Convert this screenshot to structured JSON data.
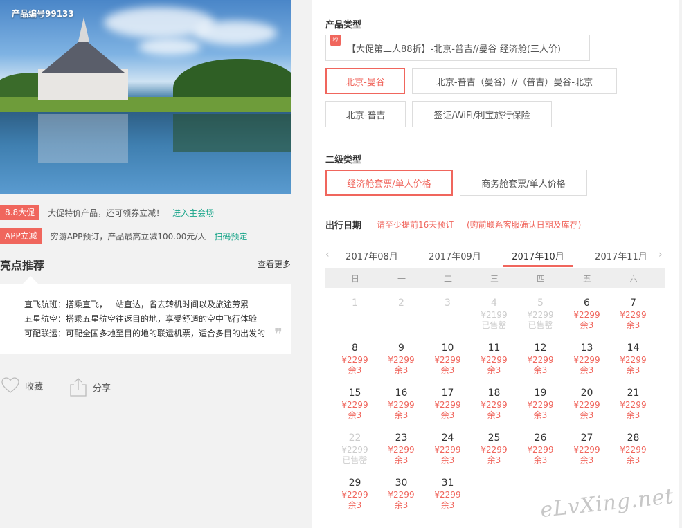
{
  "hero": {
    "product_no": "产品编号99133"
  },
  "promos": [
    {
      "tag": "8.8大促",
      "desc": "大促特价产品，还可领券立减！",
      "link": "进入主会场"
    },
    {
      "tag": "APP立减",
      "desc": "穷游APP预订，产品最高立减100.00元/人",
      "link": "扫码预定"
    }
  ],
  "highlights": {
    "title": "亮点推荐",
    "more": "查看更多",
    "lines": [
      "直飞航班：搭乘直飞，一站直达，省去转机时间以及旅途劳累",
      "五星航空：搭乘五星航空往返目的地，享受舒适的空中飞行体验",
      "可配联运：可配全国多地至目的地的联运机票，适合多目的出发的"
    ]
  },
  "actions": {
    "fav": "收藏",
    "share": "分享"
  },
  "product_type": {
    "label": "产品类型",
    "main_option": "【大促第二人88折】-北京-普吉//曼谷 经济舱(三人价)",
    "badge": "秒",
    "options": [
      "北京-曼谷",
      "北京-普吉（曼谷）//（普吉）曼谷-北京",
      "北京-普吉",
      "签证/WiFi/利宝旅行保险"
    ]
  },
  "sub_type": {
    "label": "二级类型",
    "options": [
      "经济舱套票/单人价格",
      "商务舱套票/单人价格"
    ]
  },
  "date": {
    "label": "出行日期",
    "note1": "请至少提前16天预订",
    "note2": "(购前联系客服确认日期及库存)",
    "months": [
      "2017年08月",
      "2017年09月",
      "2017年10月",
      "2017年11月"
    ],
    "prev_arrow": "‹",
    "next_arrow": "›",
    "weekdays": [
      "日",
      "一",
      "二",
      "三",
      "四",
      "五",
      "六"
    ]
  },
  "calendar": [
    {
      "d": "1",
      "p": "",
      "s": "",
      "dis": true
    },
    {
      "d": "2",
      "p": "",
      "s": "",
      "dis": true
    },
    {
      "d": "3",
      "p": "",
      "s": "",
      "dis": true
    },
    {
      "d": "4",
      "p": "¥2199",
      "s": "已售罄",
      "dis": true
    },
    {
      "d": "5",
      "p": "¥2299",
      "s": "已售罄",
      "dis": true
    },
    {
      "d": "6",
      "p": "¥2299",
      "s": "余3",
      "dis": false
    },
    {
      "d": "7",
      "p": "¥2299",
      "s": "余3",
      "dis": false
    },
    {
      "d": "8",
      "p": "¥2299",
      "s": "余3",
      "dis": false
    },
    {
      "d": "9",
      "p": "¥2299",
      "s": "余3",
      "dis": false
    },
    {
      "d": "10",
      "p": "¥2299",
      "s": "余3",
      "dis": false
    },
    {
      "d": "11",
      "p": "¥2299",
      "s": "余3",
      "dis": false
    },
    {
      "d": "12",
      "p": "¥2299",
      "s": "余3",
      "dis": false
    },
    {
      "d": "13",
      "p": "¥2299",
      "s": "余3",
      "dis": false
    },
    {
      "d": "14",
      "p": "¥2299",
      "s": "余3",
      "dis": false
    },
    {
      "d": "15",
      "p": "¥2299",
      "s": "余3",
      "dis": false
    },
    {
      "d": "16",
      "p": "¥2299",
      "s": "余3",
      "dis": false
    },
    {
      "d": "17",
      "p": "¥2299",
      "s": "余3",
      "dis": false
    },
    {
      "d": "18",
      "p": "¥2299",
      "s": "余3",
      "dis": false
    },
    {
      "d": "19",
      "p": "¥2299",
      "s": "余3",
      "dis": false
    },
    {
      "d": "20",
      "p": "¥2299",
      "s": "余3",
      "dis": false
    },
    {
      "d": "21",
      "p": "¥2299",
      "s": "余3",
      "dis": false
    },
    {
      "d": "22",
      "p": "¥2299",
      "s": "已售罄",
      "dis": true
    },
    {
      "d": "23",
      "p": "¥2299",
      "s": "余3",
      "dis": false
    },
    {
      "d": "24",
      "p": "¥2299",
      "s": "余3",
      "dis": false
    },
    {
      "d": "25",
      "p": "¥2299",
      "s": "余3",
      "dis": false
    },
    {
      "d": "26",
      "p": "¥2299",
      "s": "余3",
      "dis": false
    },
    {
      "d": "27",
      "p": "¥2299",
      "s": "余3",
      "dis": false
    },
    {
      "d": "28",
      "p": "¥2299",
      "s": "余3",
      "dis": false
    },
    {
      "d": "29",
      "p": "¥2299",
      "s": "余3",
      "dis": false
    },
    {
      "d": "30",
      "p": "¥2299",
      "s": "余3",
      "dis": false
    },
    {
      "d": "31",
      "p": "¥2299",
      "s": "余3",
      "dis": false
    }
  ],
  "watermark": "eLvXing.net",
  "colors": {
    "accent": "#f0665d",
    "link": "#1aa58a"
  }
}
